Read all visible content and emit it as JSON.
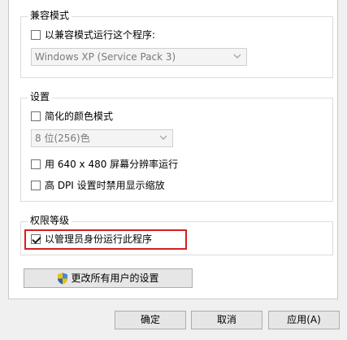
{
  "compatibility": {
    "title": "兼容模式",
    "run_in_compat_label": "以兼容模式运行这个程序:",
    "run_in_compat_checked": false,
    "os_select_value": "Windows XP (Service Pack 3)"
  },
  "settings": {
    "title": "设置",
    "reduced_color_label": "简化的颜色模式",
    "reduced_color_checked": false,
    "color_select_value": "8 位(256)色",
    "resolution_label": "用 640 x 480 屏幕分辨率运行",
    "resolution_checked": false,
    "dpi_label": "高 DPI 设置时禁用显示缩放",
    "dpi_checked": false
  },
  "privilege": {
    "title": "权限等级",
    "run_as_admin_label": "以管理员身份运行此程序",
    "run_as_admin_checked": true
  },
  "change_all_users_label": "更改所有用户的设置",
  "dialog_buttons": {
    "ok": "确定",
    "cancel": "取消",
    "apply": "应用(A)"
  },
  "colors": {
    "highlight_border": "#d42020"
  }
}
